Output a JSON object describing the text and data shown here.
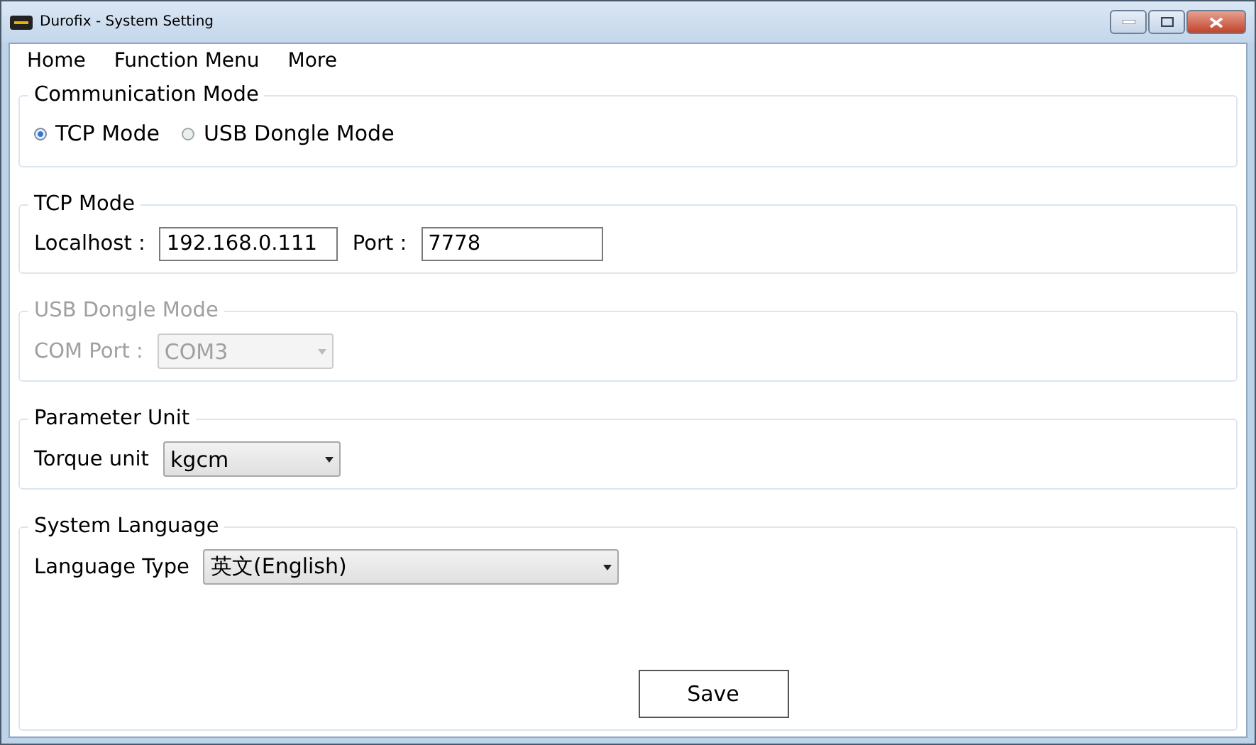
{
  "window": {
    "title": "Durofix - System Setting"
  },
  "menu": [
    {
      "label": "Home"
    },
    {
      "label": "Function Menu"
    },
    {
      "label": "More"
    }
  ],
  "communication_mode": {
    "title": "Communication Mode",
    "options": [
      {
        "label": "TCP Mode",
        "selected": true
      },
      {
        "label": "USB Dongle Mode",
        "selected": false
      }
    ]
  },
  "tcp_mode": {
    "title": "TCP Mode",
    "disabled": false,
    "localhost_label": "Localhost :",
    "localhost": "192.168.0.111",
    "port_label": "Port :",
    "port": "7778"
  },
  "usb_dongle_mode": {
    "title": "USB Dongle Mode",
    "disabled": true,
    "com_port_label": "COM Port :",
    "com_port": "COM3"
  },
  "parameter_unit": {
    "title": "Parameter Unit",
    "disabled": false,
    "torque_unit_label": "Torque unit",
    "torque_unit": "kgcm"
  },
  "system_language": {
    "title": "System Language",
    "disabled": false,
    "language_type_label": "Language Type",
    "language_type": "英文(English)",
    "save_button": "Save"
  }
}
